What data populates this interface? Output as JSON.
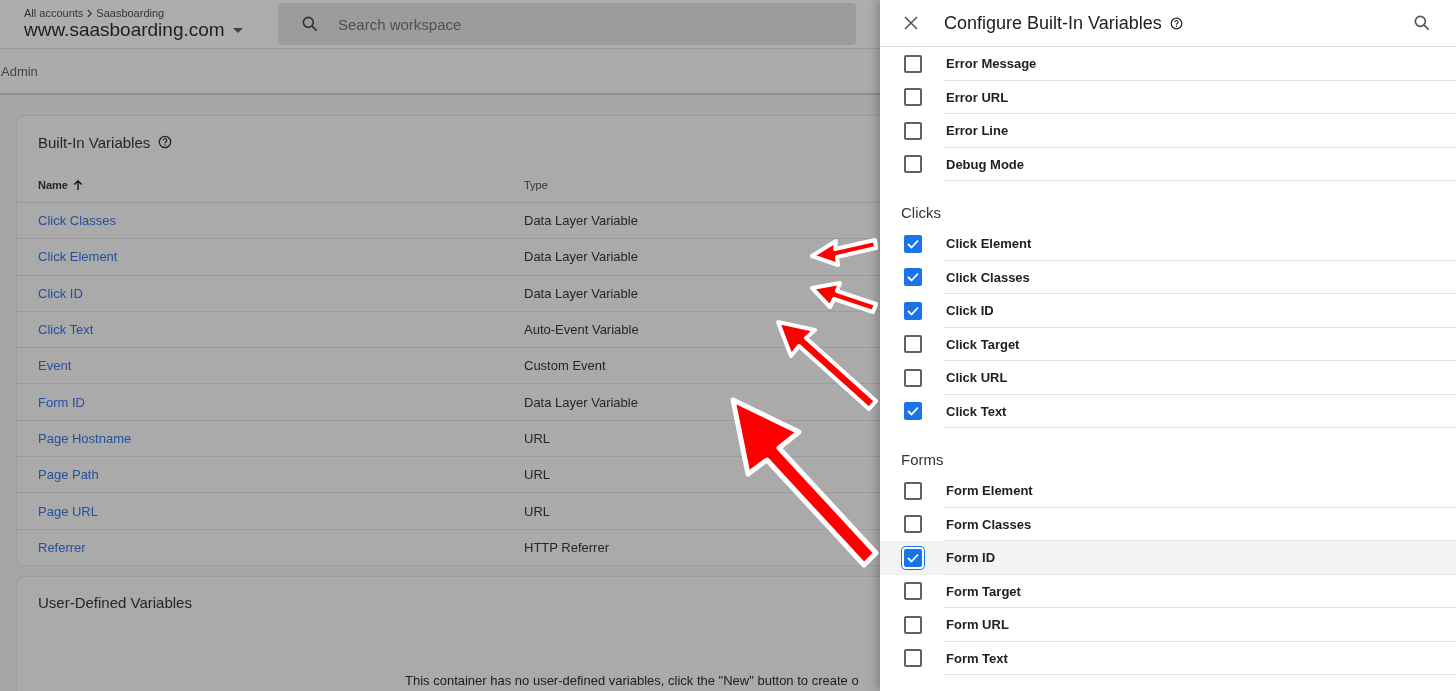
{
  "header": {
    "breadcrumb": [
      "All accounts",
      "Saasboarding"
    ],
    "container": "www.saasboarding.com",
    "search": {
      "placeholder": "Search workspace"
    }
  },
  "nav": {
    "item": "Admin"
  },
  "built_in_card": {
    "title": "Built-In Variables",
    "table": {
      "columns": [
        {
          "label": "Name",
          "sorted": true
        },
        {
          "label": "Type",
          "sorted": false
        }
      ],
      "rows": [
        {
          "name": "Click Classes",
          "type": "Data Layer Variable"
        },
        {
          "name": "Click Element",
          "type": "Data Layer Variable"
        },
        {
          "name": "Click ID",
          "type": "Data Layer Variable"
        },
        {
          "name": "Click Text",
          "type": "Auto-Event Variable"
        },
        {
          "name": "Event",
          "type": "Custom Event"
        },
        {
          "name": "Form ID",
          "type": "Data Layer Variable"
        },
        {
          "name": "Page Hostname",
          "type": "URL"
        },
        {
          "name": "Page Path",
          "type": "URL"
        },
        {
          "name": "Page URL",
          "type": "URL"
        },
        {
          "name": "Referrer",
          "type": "HTTP Referrer"
        }
      ]
    }
  },
  "user_defined_card": {
    "title": "User-Defined Variables",
    "empty_message": "This container has no user-defined variables, click the \"New\" button to create o"
  },
  "panel": {
    "title": "Configure Built-In Variables",
    "sections": [
      {
        "items": [
          {
            "label": "Error Message",
            "checked": false,
            "focused": false
          },
          {
            "label": "Error URL",
            "checked": false,
            "focused": false
          },
          {
            "label": "Error Line",
            "checked": false,
            "focused": false
          },
          {
            "label": "Debug Mode",
            "checked": false,
            "focused": false
          }
        ]
      },
      {
        "heading": "Clicks",
        "items": [
          {
            "label": "Click Element",
            "checked": true,
            "focused": false
          },
          {
            "label": "Click Classes",
            "checked": true,
            "focused": false
          },
          {
            "label": "Click ID",
            "checked": true,
            "focused": false
          },
          {
            "label": "Click Target",
            "checked": false,
            "focused": false
          },
          {
            "label": "Click URL",
            "checked": false,
            "focused": false
          },
          {
            "label": "Click Text",
            "checked": true,
            "focused": false
          }
        ]
      },
      {
        "heading": "Forms",
        "items": [
          {
            "label": "Form Element",
            "checked": false,
            "focused": false
          },
          {
            "label": "Form Classes",
            "checked": false,
            "focused": false
          },
          {
            "label": "Form ID",
            "checked": true,
            "focused": true
          },
          {
            "label": "Form Target",
            "checked": false,
            "focused": false
          },
          {
            "label": "Form URL",
            "checked": false,
            "focused": false
          },
          {
            "label": "Form Text",
            "checked": false,
            "focused": false
          }
        ]
      }
    ]
  }
}
